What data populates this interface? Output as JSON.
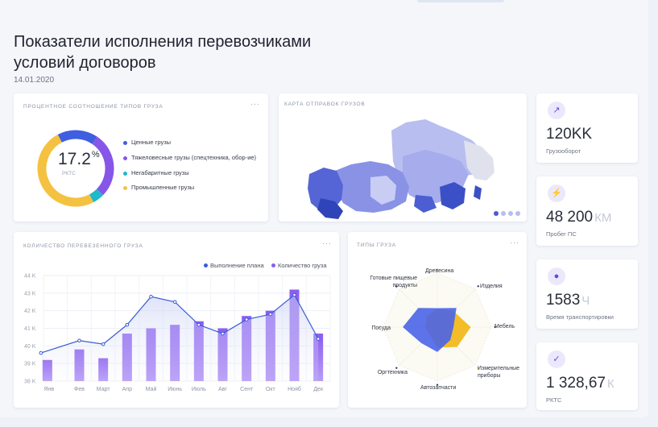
{
  "header": {
    "title": "Показатели исполнения перевозчиками условий договоров",
    "date": "14.01.2020"
  },
  "cargo_share": {
    "title": "ПРОЦЕНТНОЕ СООТНОШЕНИЕ ТИПОВ ГРУЗА",
    "menu": "···",
    "center_value": "17.2",
    "center_unit": "%",
    "center_label": "РКТС",
    "legend": [
      {
        "label": "Ценные грузы",
        "color": "#3f5ee0"
      },
      {
        "label": "Тяжеловесные грузы (спецтехника, обор-ие)",
        "color": "#8656e8"
      },
      {
        "label": "Негабаритные грузы",
        "color": "#1fb9c9"
      },
      {
        "label": "Промышленные грузы",
        "color": "#f4c240"
      }
    ]
  },
  "map": {
    "title": "КАРТА ОТПРАВОК ГРУЗОВ",
    "pager_count": 4
  },
  "kpis": [
    {
      "icon": "chart-line-icon",
      "glyph": "↗",
      "value": "120KK",
      "unit": "",
      "label": "Грузооборот"
    },
    {
      "icon": "lightning-icon",
      "glyph": "⚡",
      "value": "48 200",
      "unit": "КМ",
      "label": "Пробег ПС"
    },
    {
      "icon": "location-pin-icon",
      "glyph": "●",
      "value": "1583",
      "unit": "Ч",
      "label": "Время транспортировки"
    },
    {
      "icon": "checkmark-icon",
      "glyph": "✓",
      "value": "1 328,67",
      "unit": "К",
      "label": "РКТС"
    }
  ],
  "volume": {
    "title": "КОЛИЧЕСТВО ПЕРЕВЕЗЕННОГО ГРУЗА",
    "menu": "···",
    "legend_plan": "Выполнение плана",
    "legend_qty": "Количество груза"
  },
  "types": {
    "title": "ТИПЫ ГРУЗА",
    "menu": "···",
    "labels": [
      "Древесина",
      "Изделия",
      "Мебель",
      "Измерительные приборы",
      "Автозапчасти",
      "Оргтехника",
      "Посуда",
      "Готовые пищевые продукты"
    ]
  },
  "chart_data": [
    {
      "type": "pie",
      "title": "ПРОЦЕНТНОЕ СООТНОШЕНИЕ ТИПОВ ГРУЗА",
      "categories": [
        "Ценные грузы",
        "Тяжеловесные грузы (спецтехника, обор-ие)",
        "Негабаритные грузы",
        "Промышленные грузы"
      ],
      "values": [
        17.2,
        27.8,
        5.0,
        50.0
      ],
      "colors": [
        "#3f5ee0",
        "#8656e8",
        "#1fb9c9",
        "#f4c240"
      ],
      "center_text": "17.2%",
      "legend": "right"
    },
    {
      "type": "bar",
      "title": "КОЛИЧЕСТВО ПЕРЕВЕЗЕННОГО ГРУЗА",
      "categories": [
        "Янв",
        "Фев",
        "Март",
        "Апр",
        "Май",
        "Июнь",
        "Июль",
        "Авг",
        "Сент",
        "Окт",
        "Нояб",
        "Дек"
      ],
      "ylim": [
        38,
        44
      ],
      "yticks": [
        "38 K",
        "39 K",
        "40 K",
        "41 K",
        "42 K",
        "43 K",
        "44 K"
      ],
      "series": [
        {
          "name": "Количество груза",
          "type": "bar",
          "color": "#8a5cf0",
          "values": [
            39.2,
            39.8,
            39.3,
            40.7,
            41.0,
            41.2,
            41.4,
            41.0,
            41.7,
            42.0,
            43.2,
            40.7
          ]
        },
        {
          "name": "Выполнение плана",
          "type": "line",
          "color": "#3a5bd9",
          "values": [
            39.6,
            40.3,
            40.1,
            41.2,
            42.8,
            42.5,
            41.2,
            40.7,
            41.5,
            41.8,
            42.9,
            40.4
          ]
        }
      ],
      "grid": true,
      "legend": "top-right"
    },
    {
      "type": "radar",
      "title": "ТИПЫ ГРУЗА",
      "categories": [
        "Древесина",
        "Изделия",
        "Мебель",
        "Измерительные приборы",
        "Автозапчасти",
        "Оргтехника",
        "Посуда",
        "Готовые пищевые продукты"
      ],
      "series": [
        {
          "color": "#f2b91e",
          "values": [
            0.34,
            0.42,
            0.62,
            0.52,
            0.38,
            0.2,
            0.22,
            0.28
          ]
        },
        {
          "color": "#4a64e8",
          "values": [
            0.35,
            0.5,
            0.3,
            0.34,
            0.46,
            0.42,
            0.64,
            0.5
          ]
        }
      ]
    }
  ]
}
